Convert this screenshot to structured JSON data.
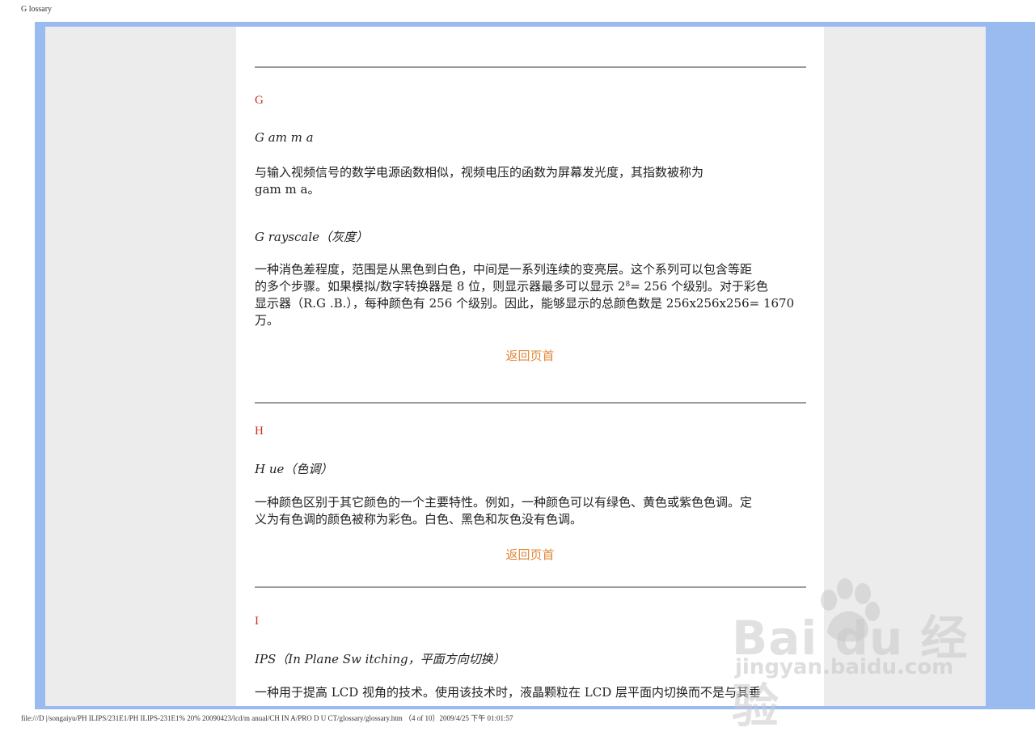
{
  "print_header": "G lossary",
  "print_footer": "file:///D |/songaiyu/PH ILIPS/231E1/PH ILIPS-231E1% 20% 20090423/lcd/m anual/CH IN A/PRO D U CT/glossary/glossary.htm （4 of 10）2009/4/25 下午 01:01:57",
  "sections": [
    {
      "letter": "G",
      "entries": [
        {
          "term": "G am m a",
          "desc_lines": [
            "与输入视频信号的数学电源函数相似，视频电压的函数为屏幕发光度，其指数被称为",
            "gam m a。"
          ]
        },
        {
          "term": "G rayscale（灰度）",
          "desc_line1": "一种消色差程度，范围是从黑色到白色，中间是一系列连续的变亮层。这个系列可以包含等距",
          "desc_line2_pre": "的多个步骤。如果模拟/数字转换器是 8 位，则显示器最多可以显示 2",
          "desc_line2_sup": "8",
          "desc_line2_post": "= 256 个级别。对于彩色",
          "desc_line3": "显示器（R.G .B.），每种颜色有 256 个级别。因此，能够显示的总颜色数是 256x256x256= 1670",
          "desc_line4": "万。"
        }
      ],
      "back_link": "返回页首"
    },
    {
      "letter": "H",
      "entries": [
        {
          "term": "H ue（色调）",
          "desc_lines": [
            "一种颜色区别于其它颜色的一个主要特性。例如，一种颜色可以有绿色、黄色或紫色色调。定",
            "义为有色调的颜色被称为彩色。白色、黑色和灰色没有色调。"
          ]
        }
      ],
      "back_link": "返回页首"
    },
    {
      "letter": "I",
      "entries": [
        {
          "term": "IPS（In Plane Sw itching，平面方向切换）",
          "desc_lines": [
            "一种用于提高 LCD 视角的技术。使用该技术时，液晶颗粒在 LCD 层平面内切换而不是与其垂"
          ]
        }
      ]
    }
  ],
  "watermark": {
    "brand": "Bai du 经验",
    "url": "jingyan.baidu.com"
  },
  "colors": {
    "frame_blue": "#99bbf0",
    "panel_gray": "#ececec",
    "letter_red": "#d03020",
    "link_orange": "#e0883a"
  }
}
